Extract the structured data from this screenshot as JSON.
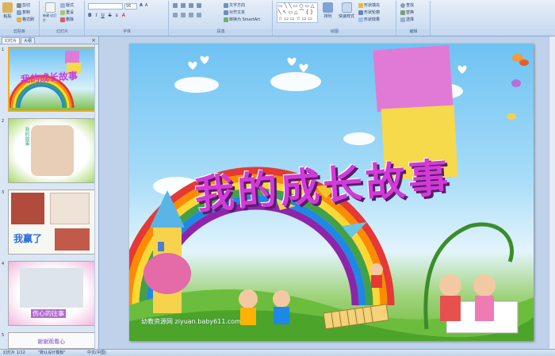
{
  "ribbon": {
    "groups": [
      {
        "label": "剪贴板"
      },
      {
        "label": "幻灯片"
      },
      {
        "label": "字体"
      },
      {
        "label": "段落"
      },
      {
        "label": "绘图"
      },
      {
        "label": "编辑"
      }
    ],
    "clipboard": {
      "paste": "粘贴",
      "cut": "剪切",
      "copy": "复制",
      "format_painter": "格式刷"
    },
    "slides": {
      "new_slide": "新建\n幻灯片",
      "layout": "版式",
      "reset": "重设",
      "delete": "删除"
    },
    "font": {
      "font_name": "",
      "font_size": "96"
    },
    "paragraph": {
      "text_direction": "文字方向",
      "align_text": "对齐文本",
      "convert_smartart": "转换为 SmartArt"
    },
    "drawing": {
      "arrange": "排列",
      "quick_styles": "快速样式",
      "shape_fill": "形状填充",
      "shape_outline": "形状轮廓",
      "shape_effects": "形状效果"
    },
    "editing": {
      "find": "查找",
      "replace": "替换",
      "select": "选择"
    }
  },
  "left_pane": {
    "tabs": [
      "幻灯片",
      "大纲"
    ],
    "close": "×",
    "thumbnails": [
      {
        "number": "1",
        "title": "我的成长故事",
        "selected": true
      },
      {
        "number": "2",
        "title": "我的故事",
        "selected": false
      },
      {
        "number": "3",
        "title": "我赢了",
        "selected": false
      },
      {
        "number": "4",
        "title": "伤心的往事",
        "selected": false
      },
      {
        "number": "5",
        "title": "谢谢观看心",
        "selected": false
      }
    ]
  },
  "slide": {
    "title": "我的成长故事",
    "watermark": "幼教资源网 ziyuan.baby611.com"
  },
  "status_bar": {
    "slide_info": "幻灯片 1/12",
    "theme": "\"默认设计模板\"",
    "language": "中文(中国)"
  },
  "colors": {
    "title_fill": "#d23bd8",
    "sticky_pink": "#e07ad6",
    "sticky_yellow": "#f7d94c",
    "ribbon_bg": "#c5d8f0",
    "selection": "#f6a91d"
  }
}
